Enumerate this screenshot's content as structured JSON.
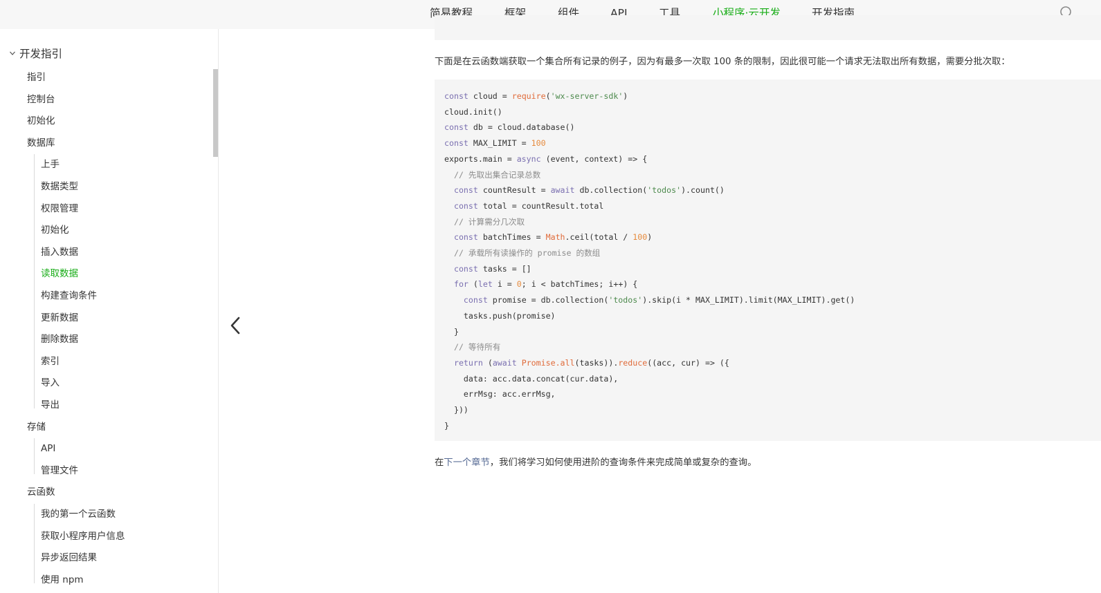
{
  "topnav": {
    "items": [
      "简易教程",
      "框架",
      "组件",
      "API",
      "工具",
      "小程序·云开发",
      "开发指南"
    ],
    "active_index": 5
  },
  "sidebar": {
    "section": "开发指引",
    "items": [
      {
        "label": "指引",
        "level": 1
      },
      {
        "label": "控制台",
        "level": 1
      },
      {
        "label": "初始化",
        "level": 1
      },
      {
        "label": "数据库",
        "level": 1
      },
      {
        "label": "上手",
        "level": 2
      },
      {
        "label": "数据类型",
        "level": 2
      },
      {
        "label": "权限管理",
        "level": 2
      },
      {
        "label": "初始化",
        "level": 2
      },
      {
        "label": "插入数据",
        "level": 2
      },
      {
        "label": "读取数据",
        "level": 2,
        "active": true
      },
      {
        "label": "构建查询条件",
        "level": 2
      },
      {
        "label": "更新数据",
        "level": 2
      },
      {
        "label": "删除数据",
        "level": 2
      },
      {
        "label": "索引",
        "level": 2
      },
      {
        "label": "导入",
        "level": 2
      },
      {
        "label": "导出",
        "level": 2
      },
      {
        "label": "存储",
        "level": 1
      },
      {
        "label": "API",
        "level": 2
      },
      {
        "label": "管理文件",
        "level": 2
      },
      {
        "label": "云函数",
        "level": 1
      },
      {
        "label": "我的第一个云函数",
        "level": 2
      },
      {
        "label": "获取小程序用户信息",
        "level": 2
      },
      {
        "label": "异步返回结果",
        "level": 2
      },
      {
        "label": "使用 npm",
        "level": 2
      }
    ]
  },
  "content": {
    "intro": "下面是在云函数端获取一个集合所有记录的例子，因为有最多一次取 100 条的限制，因此很可能一个请求无法取出所有数据，需要分批次取：",
    "code_lines": [
      "const cloud = require('wx-server-sdk')",
      "cloud.init()",
      "const db = cloud.database()",
      "const MAX_LIMIT = 100",
      "exports.main = async (event, context) => {",
      "  // 先取出集合记录总数",
      "  const countResult = await db.collection('todos').count()",
      "  const total = countResult.total",
      "  // 计算需分几次取",
      "  const batchTimes = Math.ceil(total / 100)",
      "  // 承载所有读操作的 promise 的数组",
      "  const tasks = []",
      "  for (let i = 0; i < batchTimes; i++) {",
      "    const promise = db.collection('todos').skip(i * MAX_LIMIT).limit(MAX_LIMIT).get()",
      "    tasks.push(promise)",
      "  }",
      "  // 等待所有",
      "  return (await Promise.all(tasks)).reduce((acc, cur) => ({",
      "    data: acc.data.concat(cur.data),",
      "    errMsg: acc.errMsg,",
      "  }))",
      "}"
    ],
    "outro_before": "在",
    "outro_link": "下一个章节",
    "outro_after": "，我们将学习如何使用进阶的查询条件来完成简单或复杂的查询。"
  },
  "colors": {
    "accent": "#1aad19",
    "link": "#576b95",
    "code_bg": "#f5f5f5",
    "nav_bg": "#f7f7f7"
  },
  "icons": {
    "search": "search-icon",
    "prev": "chevron-left-icon",
    "collapse": "chevron-down-icon"
  }
}
